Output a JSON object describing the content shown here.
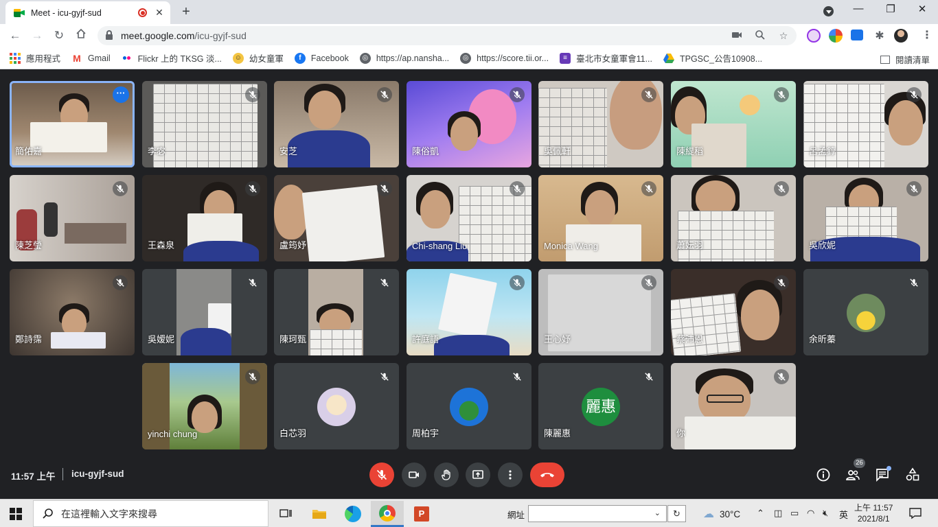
{
  "browser": {
    "tab_title": "Meet - icu-gyjf-sud",
    "url_host": "meet.google.com",
    "url_path": "/icu-gyjf-sud",
    "bookmarks": [
      "應用程式",
      "Gmail",
      "Flickr 上的 TKSG 淡...",
      "幼女童軍",
      "Facebook",
      "https://ap.nansha...",
      "https://score.tii.or...",
      "臺北市女童軍會11...",
      "TPGSC_公告10908..."
    ],
    "reading_list": "閱讀清單"
  },
  "participants": [
    {
      "name": "簡佑嘉"
    },
    {
      "name": "李宓"
    },
    {
      "name": "安芝"
    },
    {
      "name": "陳俗凱"
    },
    {
      "name": "吳佩軒"
    },
    {
      "name": "陳緹稻"
    },
    {
      "name": "呂孟錞"
    },
    {
      "name": "陳芝瑩"
    },
    {
      "name": "王森泉"
    },
    {
      "name": "盧筠妤"
    },
    {
      "name": "Chi-shang Liu"
    },
    {
      "name": "Monica Wang"
    },
    {
      "name": "蕭妘羽"
    },
    {
      "name": "吳欣妮"
    },
    {
      "name": "鄭詩霈"
    },
    {
      "name": "吳嫒妮"
    },
    {
      "name": "陳珂甄"
    },
    {
      "name": "許庭語"
    },
    {
      "name": "王心妤"
    },
    {
      "name": "蔡沛恩"
    },
    {
      "name": "余昕蓁"
    },
    {
      "name": "yinchi chung"
    },
    {
      "name": "白芯羽"
    },
    {
      "name": "周柏宇"
    },
    {
      "name": "陳麗惠",
      "initials": "麗惠"
    },
    {
      "name": "你"
    }
  ],
  "meeting": {
    "time": "11:57 上午",
    "code": "icu-gyjf-sud",
    "participant_count": "26"
  },
  "taskbar": {
    "search_placeholder": "在這裡輸入文字來搜尋",
    "address_label": "網址",
    "temperature": "30°C",
    "ime": "英",
    "time": "上午 11:57",
    "date": "2021/8/1"
  },
  "colors": {
    "meet_bg": "#202124",
    "tile_bg": "#3c4043",
    "end_call": "#ea4335",
    "active_outline": "#8ab4f8"
  }
}
